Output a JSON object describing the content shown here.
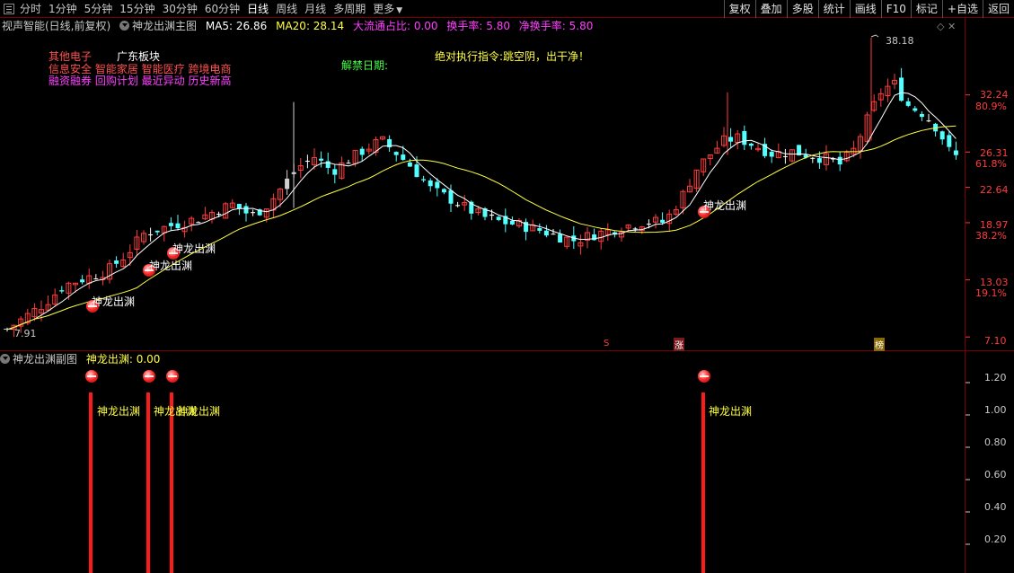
{
  "toolbar": {
    "periods": [
      "分时",
      "1分钟",
      "5分钟",
      "15分钟",
      "30分钟",
      "60分钟",
      "日线",
      "周线",
      "月线",
      "多周期",
      "更多"
    ],
    "active_period": "日线",
    "buttons": [
      "复权",
      "叠加",
      "多股",
      "统计",
      "画线",
      "F10",
      "标记",
      "+自选",
      "返回"
    ]
  },
  "info": {
    "stock": "视声智能(日线,前复权)",
    "indicator": "神龙出渊主图",
    "ma5": "MA5: 26.86",
    "ma20": "MA20: 28.14",
    "float_ratio": "大流通占比: 0.00",
    "turnover": "换手率: 5.80",
    "net_turnover": "净换手率: 5.80",
    "icons": "◇ ✕"
  },
  "tags": {
    "industry": "其他电子",
    "region": "广东板块",
    "concepts1": "信息安全 智能家居 智能医疗 跨境电商",
    "concepts2": "融资融券 回购计划 最近异动 历史新高",
    "unlock": "解禁日期:",
    "instruction": "绝对执行指令:跳空阴，出干净！"
  },
  "main_axis": {
    "price_labels": [
      "32.24",
      "26.31",
      "22.64",
      "18.97",
      "13.03",
      "7.10"
    ],
    "pct_labels": [
      "80.9%",
      "61.8%",
      "38.2%",
      "19.1%"
    ],
    "high_label": "38.18",
    "low_label": "7.91"
  },
  "signals": {
    "label": "神龙出渊",
    "positions": [
      0.1,
      0.16,
      0.18,
      0.69
    ]
  },
  "markers": {
    "s": "S",
    "zhang": "涨",
    "bang": "榜"
  },
  "sub": {
    "title": "神龙出渊副图",
    "value": "神龙出渊: 0.00",
    "axis_labels": [
      "1.20",
      "1.00",
      "0.80",
      "0.60",
      "0.40",
      "0.20"
    ],
    "label": "神龙出渊",
    "bars": [
      1,
      1,
      1,
      1
    ]
  },
  "colors": {
    "up": "#ff3c3c",
    "down": "#54ffff",
    "flat": "#ffffff",
    "ma5": "#ffffff",
    "ma20": "#ffff40",
    "axis_red": "#ff3c3c"
  },
  "chart_data": {
    "type": "candlestick",
    "ylim": [
      7.1,
      38.18
    ],
    "series": [
      {
        "name": "MA5",
        "values": [
          26.86
        ]
      },
      {
        "name": "MA20",
        "values": [
          28.14
        ]
      }
    ]
  }
}
